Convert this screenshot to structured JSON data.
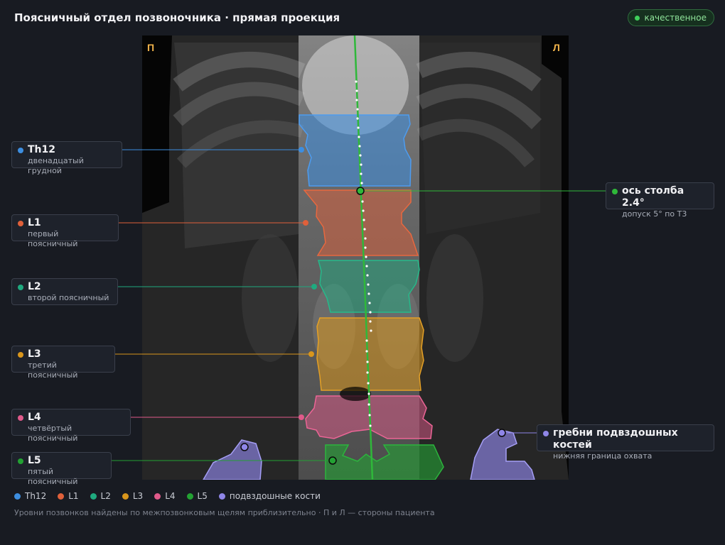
{
  "header": {
    "title": "Поясничный отдел позвоночника · прямая проекция",
    "badge": "качественное"
  },
  "image": {
    "side_right": "П",
    "side_left": "Л"
  },
  "vertebrae": [
    {
      "id": "Th12",
      "name": "Th12",
      "sub": "двенадцатый грудной",
      "color": "#3d8ee0"
    },
    {
      "id": "L1",
      "name": "L1",
      "sub": "первый поясничный",
      "color": "#e0603a"
    },
    {
      "id": "L2",
      "name": "L2",
      "sub": "второй поясничный",
      "color": "#1faa7f"
    },
    {
      "id": "L3",
      "name": "L3",
      "sub": "третий поясничный",
      "color": "#d9961c"
    },
    {
      "id": "L4",
      "name": "L4",
      "sub": "четвёртый поясничный",
      "color": "#e05a8a"
    },
    {
      "id": "L5",
      "name": "L5",
      "sub": "пятый поясничный",
      "color": "#23a133"
    }
  ],
  "axis": {
    "name": "ось столба 2.4°",
    "sub": "допуск 5° по Т3",
    "color": "#2fb83a"
  },
  "iliac": {
    "name": "гребни подвздошных костей",
    "sub": "нижняя граница охвата",
    "color": "#8f86e8"
  },
  "legend": [
    {
      "label": "Th12",
      "color": "#3d8ee0"
    },
    {
      "label": "L1",
      "color": "#e0603a"
    },
    {
      "label": "L2",
      "color": "#1faa7f"
    },
    {
      "label": "L3",
      "color": "#d9961c"
    },
    {
      "label": "L4",
      "color": "#e05a8a"
    },
    {
      "label": "L5",
      "color": "#23a133"
    },
    {
      "label": "подвздошные кости",
      "color": "#8f86e8"
    }
  ],
  "footnote": "Уровни позвонков найдены по межпозвонковым щелям приблизительно · П и Л — стороны пациента"
}
